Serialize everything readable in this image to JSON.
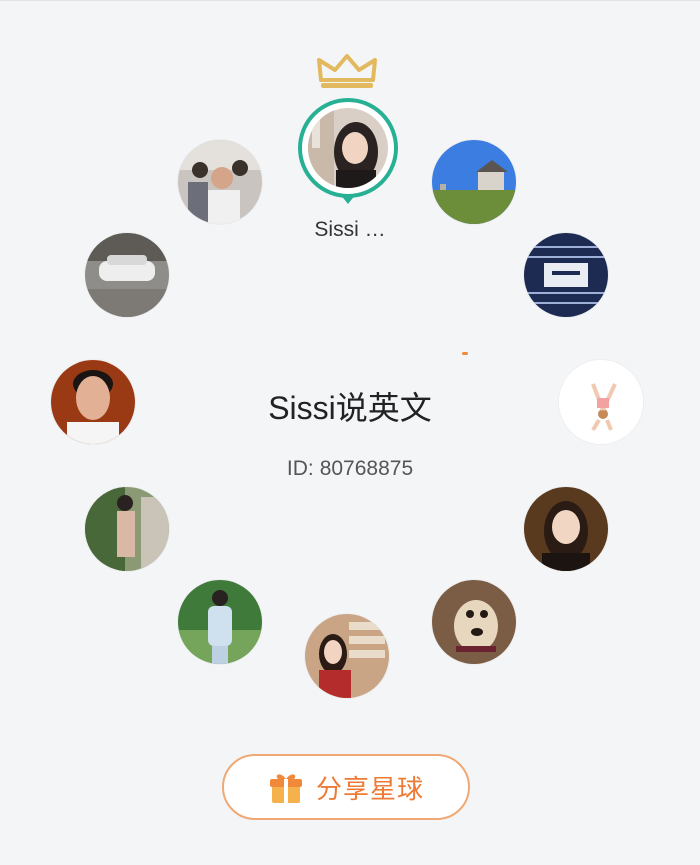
{
  "owner": {
    "name": "Sissi …",
    "crown_icon": "crown-icon"
  },
  "group": {
    "title": "Sissi说英文",
    "id_label": "ID:",
    "id_value": "80768875"
  },
  "members": [
    {
      "name": "member-meeting-photo"
    },
    {
      "name": "member-house-photo"
    },
    {
      "name": "member-car-photo"
    },
    {
      "name": "member-product-photo"
    },
    {
      "name": "member-man-portrait"
    },
    {
      "name": "member-yoga-illustration"
    },
    {
      "name": "member-woman-garden"
    },
    {
      "name": "member-woman-portrait"
    },
    {
      "name": "member-woman-park"
    },
    {
      "name": "member-dog-photo"
    },
    {
      "name": "member-woman-library"
    }
  ],
  "share_button": {
    "label": "分享星球",
    "icon": "gift-icon"
  },
  "colors": {
    "accent_green": "#27b093",
    "accent_orange": "#ee7b35",
    "crown_gold": "#e3b95f"
  }
}
